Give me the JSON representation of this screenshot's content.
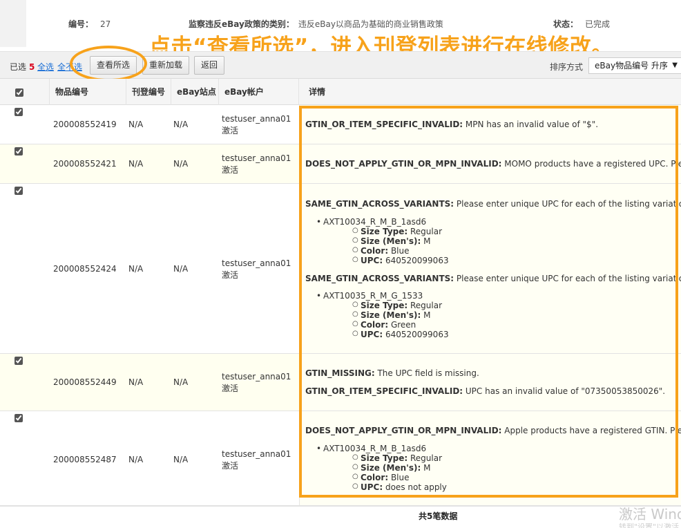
{
  "info": {
    "id_label": "编号：",
    "id_value": "27",
    "category_label": "监察违反eBay政策的类别：",
    "category_value": "违反eBay以商品为基础的商业销售政策",
    "status_label": "状态：",
    "status_value": "已完成"
  },
  "annotation": "点击“查看所选”，进入刊登列表进行在线修改。",
  "toolbar": {
    "selected_label": "已选",
    "selected_count": "5",
    "select_all": "全选",
    "select_none": "全不选",
    "view_selected": "查看所选",
    "reload": "重新加载",
    "back": "返回",
    "sort_label": "排序方式",
    "sort_value": "eBay物品编号 升序"
  },
  "columns": {
    "item_id": "物品编号",
    "listing_id": "刊登编号",
    "site": "eBay站点",
    "account": "eBay帐户",
    "details": "详情"
  },
  "rows": [
    {
      "item_id": "200008552419",
      "listing_id": "N/A",
      "site": "N/A",
      "account": "testuser_anna01",
      "account_status": "激活",
      "err1_code": "GTIN_OR_ITEM_SPECIFIC_INVALID:",
      "err1_msg": " MPN has an invalid value of \"$\"."
    },
    {
      "item_id": "200008552421",
      "listing_id": "N/A",
      "site": "N/A",
      "account": "testuser_anna01",
      "account_status": "激活",
      "err1_code": "DOES_NOT_APPLY_GTIN_OR_MPN_INVALID:",
      "err1_msg": " MOMO products have a registered UPC. Please enter"
    },
    {
      "item_id": "200008552424",
      "listing_id": "N/A",
      "site": "N/A",
      "account": "testuser_anna01",
      "account_status": "激活",
      "err1_code": "SAME_GTIN_ACROSS_VARIANTS:",
      "err1_msg": " Please enter unique UPC for each of the listing variations, or you",
      "v1_sku": "AXT10034_R_M_B_1asd6",
      "v1_specs": [
        {
          "k": "Size Type:",
          "v": " Regular"
        },
        {
          "k": "Size (Men's):",
          "v": " M"
        },
        {
          "k": "Color:",
          "v": " Blue"
        },
        {
          "k": "UPC:",
          "v": " 640520099063"
        }
      ],
      "err2_code": "SAME_GTIN_ACROSS_VARIANTS:",
      "err2_msg": " Please enter unique UPC for each of the listing variations, or you",
      "v2_sku": "AXT10035_R_M_G_1533",
      "v2_specs": [
        {
          "k": "Size Type:",
          "v": " Regular"
        },
        {
          "k": "Size (Men's):",
          "v": " M"
        },
        {
          "k": "Color:",
          "v": " Green"
        },
        {
          "k": "UPC:",
          "v": " 640520099063"
        }
      ]
    },
    {
      "item_id": "200008552449",
      "listing_id": "N/A",
      "site": "N/A",
      "account": "testuser_anna01",
      "account_status": "激活",
      "err1_code": "GTIN_MISSING:",
      "err1_msg": " The UPC field is missing.",
      "err2_code": "GTIN_OR_ITEM_SPECIFIC_INVALID:",
      "err2_msg": " UPC has an invalid value of \"07350053850026\"."
    },
    {
      "item_id": "200008552487",
      "listing_id": "N/A",
      "site": "N/A",
      "account": "testuser_anna01",
      "account_status": "激活",
      "err1_code": "DOES_NOT_APPLY_GTIN_OR_MPN_INVALID:",
      "err1_msg": " Apple products have a registered GTIN. Please ente",
      "v1_sku": "AXT10034_R_M_B_1asd6",
      "v1_specs": [
        {
          "k": "Size Type:",
          "v": " Regular"
        },
        {
          "k": "Size (Men's):",
          "v": " M"
        },
        {
          "k": "Color:",
          "v": " Blue"
        },
        {
          "k": "UPC:",
          "v": " does not apply"
        }
      ]
    }
  ],
  "footer_total": "共5笔数据",
  "watermark": "激活 Windows",
  "watermark_sub": "转到\"设置\"以激活"
}
